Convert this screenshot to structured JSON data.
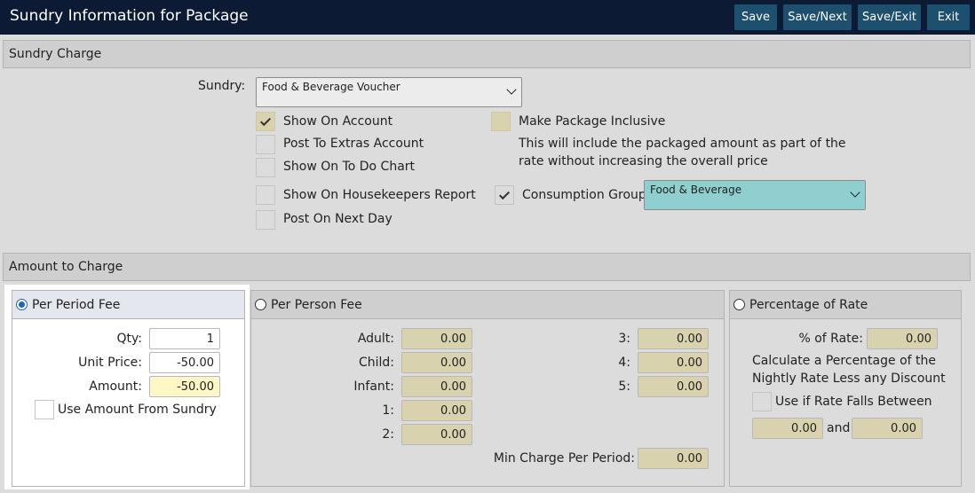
{
  "header": {
    "title": "Sundry Information for Package",
    "buttons": {
      "save": "Save",
      "save_next": "Save/Next",
      "save_exit": "Save/Exit",
      "exit": "Exit"
    }
  },
  "sundry_charge": {
    "section_title": "Sundry Charge",
    "sundry_label": "Sundry:",
    "sundry_value": "Food & Beverage Voucher",
    "show_on_account": {
      "label": "Show On Account",
      "checked": true
    },
    "post_to_extras": {
      "label": "Post To Extras Account",
      "checked": false
    },
    "show_on_todo": {
      "label": "Show On To Do Chart",
      "checked": false
    },
    "show_on_housekeepers": {
      "label": "Show On Housekeepers Report",
      "checked": false
    },
    "post_on_next_day": {
      "label": "Post On Next Day",
      "checked": false
    },
    "make_package_inclusive": {
      "label": "Make Package Inclusive",
      "checked": false
    },
    "inclusive_note_line1": "This will include the packaged amount as part of the",
    "inclusive_note_line2": "rate without increasing the overall price",
    "consumption_group": {
      "label": "Consumption Group",
      "checked": true,
      "value": "Food & Beverage"
    }
  },
  "amount_to_charge": {
    "section_title": "Amount to Charge",
    "per_period": {
      "title": "Per Period Fee",
      "selected": true,
      "qty_label": "Qty:",
      "qty": "1",
      "unit_price_label": "Unit Price:",
      "unit_price": "-50.00",
      "amount_label": "Amount:",
      "amount": "-50.00",
      "use_amount_label": "Use Amount From Sundry"
    },
    "per_person": {
      "title": "Per Person Fee",
      "selected": false,
      "adult_label": "Adult:",
      "adult": "0.00",
      "child_label": "Child:",
      "child": "0.00",
      "infant_label": "Infant:",
      "infant": "0.00",
      "one_label": "1:",
      "one": "0.00",
      "two_label": "2:",
      "two": "0.00",
      "three_label": "3:",
      "three": "0.00",
      "four_label": "4:",
      "four": "0.00",
      "five_label": "5:",
      "five": "0.00",
      "min_charge_label": "Min Charge Per Period:",
      "min_charge": "0.00"
    },
    "percentage": {
      "title": "Percentage of Rate",
      "selected": false,
      "pct_label": "% of Rate:",
      "pct": "0.00",
      "note_line1": "Calculate a Percentage of the",
      "note_line2": "Nightly Rate Less any Discount",
      "use_if_label": "Use if Rate Falls Between",
      "from": "0.00",
      "and_label": "and",
      "to": "0.00"
    }
  },
  "colors": {
    "title_bar": "#0c1a33",
    "button": "#1d4f6e",
    "tan_input": "#d8d2ae",
    "consumption_select": "#8fcfd0",
    "active_panel": "#ffffff",
    "radio_selected": "#1f63c4"
  }
}
